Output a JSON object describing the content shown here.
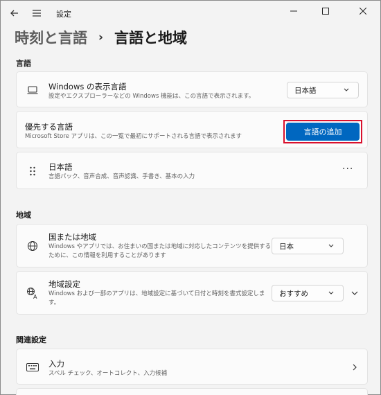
{
  "window": {
    "title": "設定"
  },
  "breadcrumb": {
    "parent": "時刻と言語",
    "separator": "›",
    "current": "言語と地域"
  },
  "sections": {
    "language": "言語",
    "region": "地域",
    "related": "関連設定"
  },
  "display_language": {
    "title": "Windows の表示言語",
    "subtitle": "設定やエクスプローラーなどの Windows 機能は、この言語で表示されます。",
    "value": "日本語"
  },
  "preferred_languages": {
    "title": "優先する言語",
    "subtitle": "Microsoft Store アプリは、この一覧で最初にサポートされる言語で表示されます",
    "add_button": "言語の追加"
  },
  "language_item": {
    "title": "日本語",
    "subtitle": "言語パック、音声合成、音声認識、手書き、基本の入力",
    "more": "···"
  },
  "country": {
    "title": "国または地域",
    "subtitle_line1": "Windows やアプリでは、お住まいの国または地域に対応したコンテンツを提供する",
    "subtitle_line2": "ために、この情報を利用することがあります",
    "value": "日本"
  },
  "regional_format": {
    "title": "地域設定",
    "subtitle_line1": "Windows および一部のアプリは、地域設定に基づいて日付と時刻を書式設定しま",
    "subtitle_line2": "す。",
    "value": "おすすめ"
  },
  "typing": {
    "title": "入力",
    "subtitle": "スペル チェック、オートコレクト、入力候補"
  },
  "colors": {
    "accent": "#0067c0",
    "highlight": "#d9102d"
  }
}
